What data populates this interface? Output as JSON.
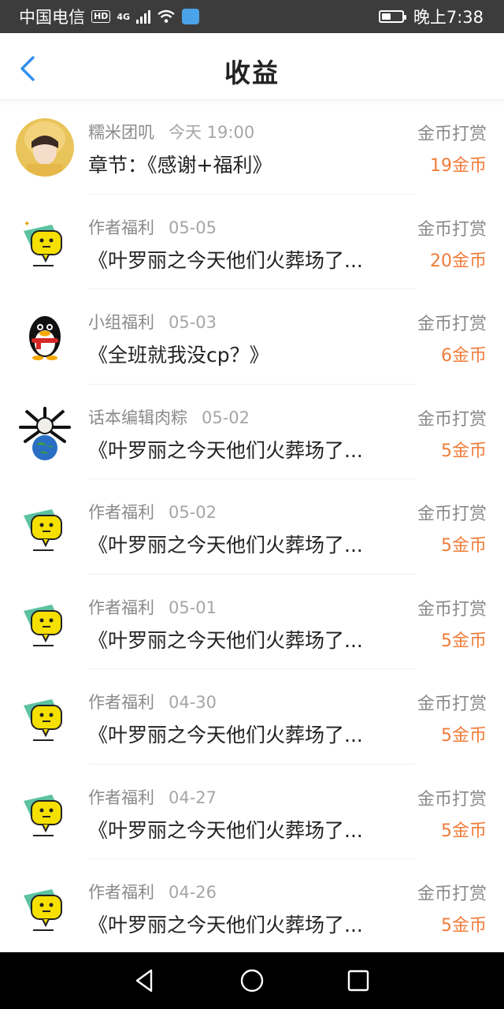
{
  "status_bar": {
    "carrier": "中国电信",
    "hd": "HD",
    "network": "4G",
    "time": "晚上7:38"
  },
  "header": {
    "title": "收益",
    "accent_color": "#2f8ff0"
  },
  "colors": {
    "amount": "#f07d3a",
    "secondary": "#8a8a8a"
  },
  "items": [
    {
      "avatar": "photo-avatar",
      "name": "糯米团叽",
      "date": "今天 19:00",
      "desc": "章节：《感谢+福利》",
      "type": "金币打赏",
      "amount": "19金币"
    },
    {
      "avatar": "chat-bubble-avatar",
      "name": "作者福利",
      "date": "05-05",
      "desc": "《叶罗丽之今天他们火葬场了...",
      "type": "金币打赏",
      "amount": "20金币"
    },
    {
      "avatar": "penguin-avatar",
      "name": "小组福利",
      "date": "05-03",
      "desc": "《全班就我没cp？》",
      "type": "金币打赏",
      "amount": "6金币"
    },
    {
      "avatar": "globe-creature-avatar",
      "name": "话本编辑肉粽",
      "date": "05-02",
      "desc": "《叶罗丽之今天他们火葬场了...",
      "type": "金币打赏",
      "amount": "5金币"
    },
    {
      "avatar": "chat-bubble-avatar",
      "name": "作者福利",
      "date": "05-02",
      "desc": "《叶罗丽之今天他们火葬场了...",
      "type": "金币打赏",
      "amount": "5金币"
    },
    {
      "avatar": "chat-bubble-avatar",
      "name": "作者福利",
      "date": "05-01",
      "desc": "《叶罗丽之今天他们火葬场了...",
      "type": "金币打赏",
      "amount": "5金币"
    },
    {
      "avatar": "chat-bubble-avatar",
      "name": "作者福利",
      "date": "04-30",
      "desc": "《叶罗丽之今天他们火葬场了...",
      "type": "金币打赏",
      "amount": "5金币"
    },
    {
      "avatar": "chat-bubble-avatar",
      "name": "作者福利",
      "date": "04-27",
      "desc": "《叶罗丽之今天他们火葬场了...",
      "type": "金币打赏",
      "amount": "5金币"
    },
    {
      "avatar": "chat-bubble-avatar",
      "name": "作者福利",
      "date": "04-26",
      "desc": "《叶罗丽之今天他们火葬场了...",
      "type": "金币打赏",
      "amount": "5金币"
    }
  ],
  "nav_bar": {
    "buttons": [
      "back-nav-icon",
      "home-nav-icon",
      "recents-nav-icon"
    ]
  }
}
